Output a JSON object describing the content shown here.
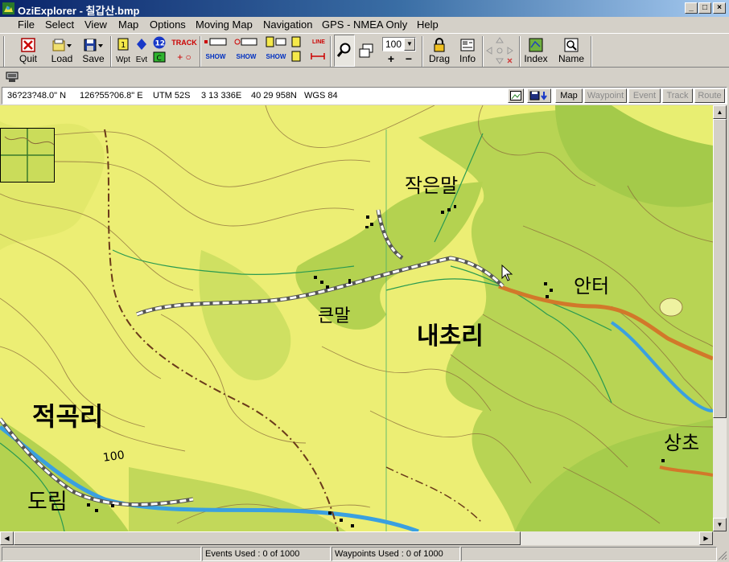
{
  "window": {
    "title": "OziExplorer - 칠갑산.bmp",
    "minimize_glyph": "_",
    "maximize_glyph": "□",
    "close_glyph": "×"
  },
  "menu": [
    "File",
    "Select",
    "View",
    "Map",
    "Options",
    "Moving Map",
    "Navigation",
    "GPS - NMEA Only",
    "Help"
  ],
  "toolbar": {
    "quit": "Quit",
    "load": "Load",
    "save": "Save",
    "wpt": "Wpt",
    "evt": "Evt",
    "track_small": "TRACK",
    "num_badge": "12",
    "c_badge": "C",
    "show1": "SHOW",
    "show2": "SHOW",
    "show3": "SHOW",
    "line_small": "LINE",
    "zoom_value": "100",
    "drag": "Drag",
    "info": "Info",
    "index": "Index",
    "name": "Name"
  },
  "coords": {
    "lat": "36?23?48.0\" N",
    "lon": "126?55?06.8\" E",
    "utm": "UTM  52S",
    "easting": "3 13 336E",
    "northing": "40 29 958N",
    "datum": "WGS 84"
  },
  "view_tabs": {
    "map": "Map",
    "waypoint": "Waypoint",
    "event": "Event",
    "track": "Track",
    "route": "Route"
  },
  "map_labels": {
    "jageunmal": "작은말",
    "keunmal": "큰말",
    "naechori": "내초리",
    "anteo": "안터",
    "jeokgokri": "적곡리",
    "dorim": "도림",
    "sangcho": "상초",
    "contour_100": "100"
  },
  "status": {
    "events": "Events Used : 0 of 1000",
    "waypoints": "Waypoints Used : 0 of 1000"
  },
  "colors": {
    "title_start": "#0a246a",
    "title_end": "#a6caf0",
    "map_yellow": "#eaed6a",
    "map_green": "#b4d64e",
    "road_orange": "#d2782a",
    "river_blue": "#3aa0e0"
  }
}
